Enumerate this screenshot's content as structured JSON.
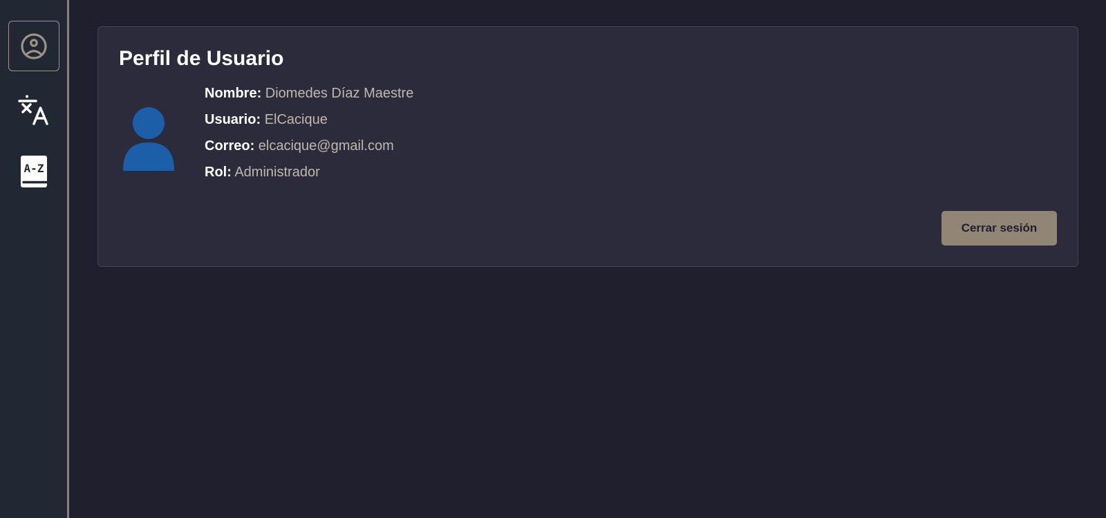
{
  "sidebar": {
    "items": [
      {
        "icon": "user-circle-icon",
        "active": true
      },
      {
        "icon": "translate-icon",
        "active": false
      },
      {
        "icon": "dictionary-icon",
        "active": false
      }
    ],
    "dictionary_icon_text": "A-Z"
  },
  "profile": {
    "title": "Perfil de Usuario",
    "avatar_icon": "person-silhouette-icon",
    "fields": [
      {
        "label": "Nombre:",
        "value": "Diomedes Díaz Maestre"
      },
      {
        "label": "Usuario:",
        "value": "ElCacique"
      },
      {
        "label": "Correo:",
        "value": "elcacique@gmail.com"
      },
      {
        "label": "Rol:",
        "value": "Administrador"
      }
    ],
    "logout_label": "Cerrar sesión"
  },
  "colors": {
    "background": "#1f1f2d",
    "sidebar": "#222833",
    "card": "#2b2b3b",
    "accent": "#918676",
    "avatar": "#1c5ea8",
    "value_text": "#c1b8ad"
  }
}
